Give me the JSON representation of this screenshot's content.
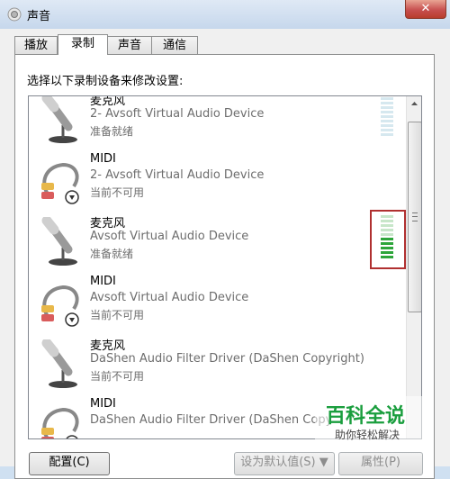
{
  "window": {
    "title": "声音",
    "close_label": "✕"
  },
  "tabs": [
    {
      "label": "播放"
    },
    {
      "label": "录制"
    },
    {
      "label": "声音"
    },
    {
      "label": "通信"
    }
  ],
  "instruction": "选择以下录制设备来修改设置:",
  "devices": [
    {
      "name": "麦克风",
      "description": "2- Avsoft Virtual Audio Device",
      "status": "准备就绪",
      "icon": "microphone-icon",
      "level": 0
    },
    {
      "name": "MIDI",
      "description": "2- Avsoft Virtual Audio Device",
      "status": "当前不可用",
      "icon": "audio-cable-icon",
      "level": null
    },
    {
      "name": "麦克风",
      "description": "Avsoft Virtual Audio Device",
      "status": "准备就绪",
      "icon": "microphone-icon",
      "level": 0.5
    },
    {
      "name": "MIDI",
      "description": "Avsoft Virtual Audio Device",
      "status": "当前不可用",
      "icon": "audio-cable-icon",
      "level": null
    },
    {
      "name": "麦克风",
      "description": "DaShen Audio Filter Driver (DaShen Copyright)",
      "status": "当前不可用",
      "icon": "microphone-icon",
      "level": null
    },
    {
      "name": "MIDI",
      "description": "DaShen Audio Filter Driver (DaShen Copy",
      "status": "",
      "icon": "audio-cable-icon",
      "level": null
    }
  ],
  "buttons": {
    "configure": "配置(C)",
    "set_default": "设为默认值(S) ▼",
    "properties": "属性(P)"
  },
  "watermark": {
    "brand": "百科全说",
    "tagline": "助你轻松解决"
  },
  "colors": {
    "meter_active": "#2da53a",
    "highlight_frame": "#b03030",
    "watermark": "#1a9e3e"
  }
}
